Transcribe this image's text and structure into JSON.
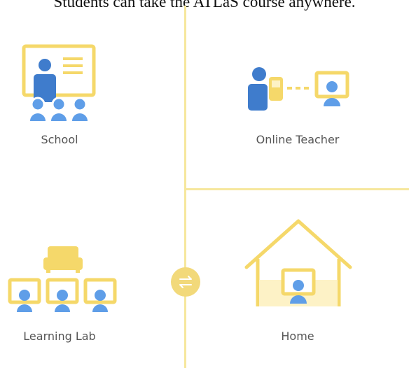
{
  "header": {
    "text": "Students can take the ATLaS course anywhere."
  },
  "locations": {
    "school": "School",
    "online_teacher": "Online Teacher",
    "learning_lab": "Learning Lab",
    "home": "Home"
  },
  "colors": {
    "yellow": "#f5d86a",
    "yellow_fill": "#fdf2c6",
    "line": "#f6e79d",
    "blue": "#3f7ccc",
    "light_blue": "#5f9ee8",
    "text": "#555555"
  }
}
